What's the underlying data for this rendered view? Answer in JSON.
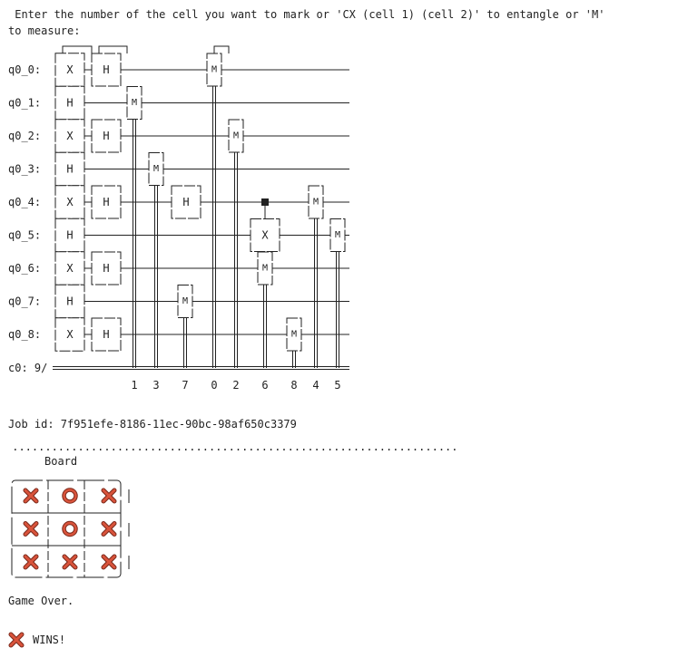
{
  "prompt": {
    "line1": " Enter the number of the cell you want to mark or 'CX (cell 1) (cell 2)' to entangle or 'M'",
    "line2": "to measure:"
  },
  "circuit": {
    "qubits": [
      "q0_0:",
      "q0_1:",
      "q0_2:",
      "q0_3:",
      "q0_4:",
      "q0_5:",
      "q0_6:",
      "q0_7:",
      "q0_8:"
    ],
    "classical_label": "c0: 9/",
    "first_layer": [
      "X",
      "H",
      "X",
      "H",
      "X",
      "H",
      "X",
      "H",
      "X"
    ],
    "h_layer_qubits": [
      0,
      2,
      4,
      6,
      8
    ],
    "h_gate_label": "H",
    "extra_h": {
      "qubit": 4,
      "label": "H"
    },
    "cx": {
      "control": 4,
      "target": 5,
      "label": "X"
    },
    "measure_label": "M",
    "measurements": [
      {
        "qubit": 1,
        "bit": "1"
      },
      {
        "qubit": 3,
        "bit": "3"
      },
      {
        "qubit": 7,
        "bit": "7"
      },
      {
        "qubit": 0,
        "bit": "0"
      },
      {
        "qubit": 2,
        "bit": "2"
      },
      {
        "qubit": 6,
        "bit": "6"
      },
      {
        "qubit": 8,
        "bit": "8"
      },
      {
        "qubit": 4,
        "bit": "4"
      },
      {
        "qubit": 5,
        "bit": "5"
      }
    ]
  },
  "job": {
    "label": "Job id: 7f951efe-8186-11ec-90bc-98af650c3379"
  },
  "separator": " ....................................................................",
  "board": {
    "title": "Board",
    "cells": [
      "X",
      "O",
      "X",
      "X",
      "O",
      "X",
      "X",
      "X",
      "X"
    ],
    "mark_color": "#d9533b",
    "mark_outline": "#7a2a1c"
  },
  "status": {
    "game_over": "Game Over.",
    "winner_icon": "cross-mark",
    "winner_text": "WINS!"
  }
}
